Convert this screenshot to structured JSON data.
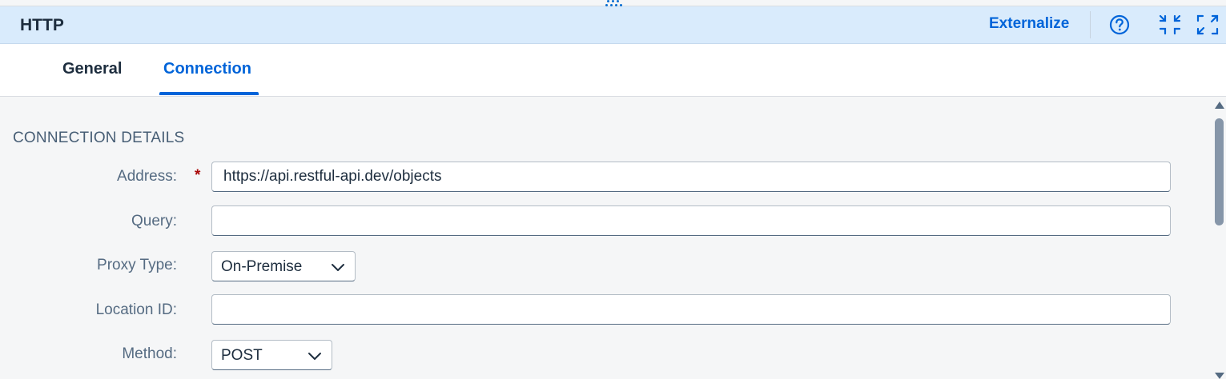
{
  "header": {
    "title": "HTTP",
    "externalize_label": "Externalize",
    "icons": [
      "help-icon",
      "exit-fullscreen-icon",
      "fullscreen-icon"
    ]
  },
  "tabs": [
    {
      "label": "General",
      "selected": false
    },
    {
      "label": "Connection",
      "selected": true
    }
  ],
  "section": {
    "title": "CONNECTION DETAILS"
  },
  "form": {
    "address": {
      "label": "Address:",
      "value": "https://api.restful-api.dev/objects",
      "required": true,
      "required_mark": "*"
    },
    "query": {
      "label": "Query:",
      "value": ""
    },
    "proxy_type": {
      "label": "Proxy Type:",
      "selected": "On-Premise"
    },
    "location_id": {
      "label": "Location ID:",
      "value": ""
    },
    "method": {
      "label": "Method:",
      "selected": "POST"
    }
  },
  "colors": {
    "accent": "#0064d9",
    "header_bg": "#d9ebfc",
    "required": "#aa0808"
  }
}
